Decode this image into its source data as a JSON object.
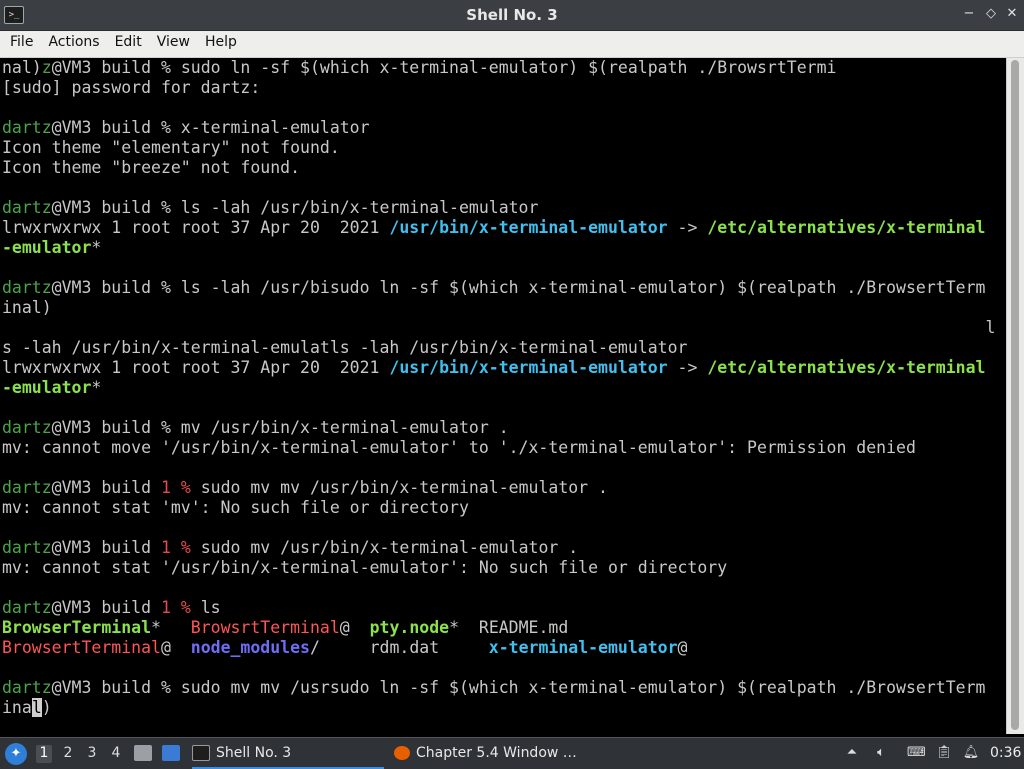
{
  "window": {
    "title": "Shell No. 3",
    "minimize_glyph": "−",
    "maximize_glyph": "◇",
    "close_glyph": "✕"
  },
  "menu": [
    {
      "label": "File"
    },
    {
      "label": "Actions"
    },
    {
      "label": "Edit"
    },
    {
      "label": "View"
    },
    {
      "label": "Help"
    }
  ],
  "terminal": {
    "lines": [
      [
        [
          "nal)",
          ""
        ],
        [
          "z",
          "s-user"
        ],
        [
          "@VM3 build % sudo ln -sf $(which x-terminal-emulator) $(realpath ./BrowsrtTermi",
          ""
        ]
      ],
      [
        [
          "[sudo] password for dartz:",
          ""
        ]
      ],
      [],
      [
        [
          "dartz",
          "s-user"
        ],
        [
          "@VM3 build % x-terminal-emulator",
          ""
        ]
      ],
      [
        [
          "Icon theme \"elementary\" not found.",
          ""
        ]
      ],
      [
        [
          "Icon theme \"breeze\" not found.",
          ""
        ]
      ],
      [],
      [
        [
          "dartz",
          "s-user"
        ],
        [
          "@VM3 build % ls -lah /usr/bin/x-terminal-emulator",
          ""
        ]
      ],
      [
        [
          "lrwxrwxrwx 1 root root 37 Apr 20  2021 ",
          ""
        ],
        [
          "/usr/bin/x-terminal-emulator",
          "s-link"
        ],
        [
          " -> ",
          ""
        ],
        [
          "/etc/alternatives/x-terminal",
          "s-target"
        ]
      ],
      [
        [
          "-emulator",
          "s-target"
        ],
        [
          "*",
          ""
        ]
      ],
      [],
      [
        [
          "dartz",
          "s-user"
        ],
        [
          "@VM3 build % ls -lah /usr/bisudo ln -sf $(which x-terminal-emulator) $(realpath ./BrowsertTerm",
          ""
        ]
      ],
      [
        [
          "inal)",
          ""
        ]
      ],
      [
        [
          "                                                                                                   l",
          ""
        ]
      ],
      [
        [
          "s -lah /usr/bin/x-terminal-emulatls -lah /usr/bin/x-terminal-emulator",
          ""
        ]
      ],
      [
        [
          "lrwxrwxrwx 1 root root 37 Apr 20  2021 ",
          ""
        ],
        [
          "/usr/bin/x-terminal-emulator",
          "s-link"
        ],
        [
          " -> ",
          ""
        ],
        [
          "/etc/alternatives/x-terminal",
          "s-target"
        ]
      ],
      [
        [
          "-emulator",
          "s-target"
        ],
        [
          "*",
          ""
        ]
      ],
      [],
      [
        [
          "dartz",
          "s-user"
        ],
        [
          "@VM3 build % mv /usr/bin/x-terminal-emulator .",
          ""
        ]
      ],
      [
        [
          "mv: cannot move '/usr/bin/x-terminal-emulator' to './x-terminal-emulator': Permission denied",
          ""
        ]
      ],
      [],
      [
        [
          "dartz",
          "s-user"
        ],
        [
          "@VM3 build ",
          ""
        ],
        [
          "1 %",
          "s-err"
        ],
        [
          " sudo mv mv /usr/bin/x-terminal-emulator .",
          ""
        ]
      ],
      [
        [
          "mv: cannot stat 'mv': No such file or directory",
          ""
        ]
      ],
      [],
      [
        [
          "dartz",
          "s-user"
        ],
        [
          "@VM3 build ",
          ""
        ],
        [
          "1 %",
          "s-err"
        ],
        [
          " sudo mv /usr/bin/x-terminal-emulator .",
          ""
        ]
      ],
      [
        [
          "mv: cannot stat '/usr/bin/x-terminal-emulator': No such file or directory",
          ""
        ]
      ],
      [],
      [
        [
          "dartz",
          "s-user"
        ],
        [
          "@VM3 build ",
          ""
        ],
        [
          "1 %",
          "s-err"
        ],
        [
          " ls",
          ""
        ]
      ],
      [
        [
          "BrowserTerminal",
          "s-exec"
        ],
        [
          "*   ",
          ""
        ],
        [
          "BrowsrtTerminal",
          "s-red"
        ],
        [
          "@  ",
          ""
        ],
        [
          "pty.node",
          "s-exec"
        ],
        [
          "*  README.md",
          ""
        ]
      ],
      [
        [
          "BrowsertTerminal",
          "s-red"
        ],
        [
          "@  ",
          ""
        ],
        [
          "node_modules",
          "s-blue"
        ],
        [
          "/     rdm.dat     ",
          ""
        ],
        [
          "x-terminal-emulator",
          "s-cyan"
        ],
        [
          "@",
          ""
        ]
      ],
      [],
      [
        [
          "dartz",
          "s-user"
        ],
        [
          "@VM3 build % sudo mv mv /usrsudo ln -sf $(which x-terminal-emulator) $(realpath ./BrowsertTerm",
          ""
        ]
      ],
      [
        [
          "ina",
          ""
        ],
        [
          "l",
          "cursor"
        ],
        [
          ")",
          ""
        ]
      ]
    ]
  },
  "taskbar": {
    "workspaces": [
      "1",
      "2",
      "3",
      "4"
    ],
    "active_workspace": "1",
    "tasks": [
      {
        "label": "Shell No. 3",
        "active": true,
        "icon": "terminal-icon"
      },
      {
        "label": "Chapter 5.4 Window …",
        "active": false,
        "icon": "firefox-icon"
      }
    ],
    "clock": "0:36",
    "colors": {
      "accent": "#3a8ee6",
      "firefox": "#e66000"
    }
  }
}
